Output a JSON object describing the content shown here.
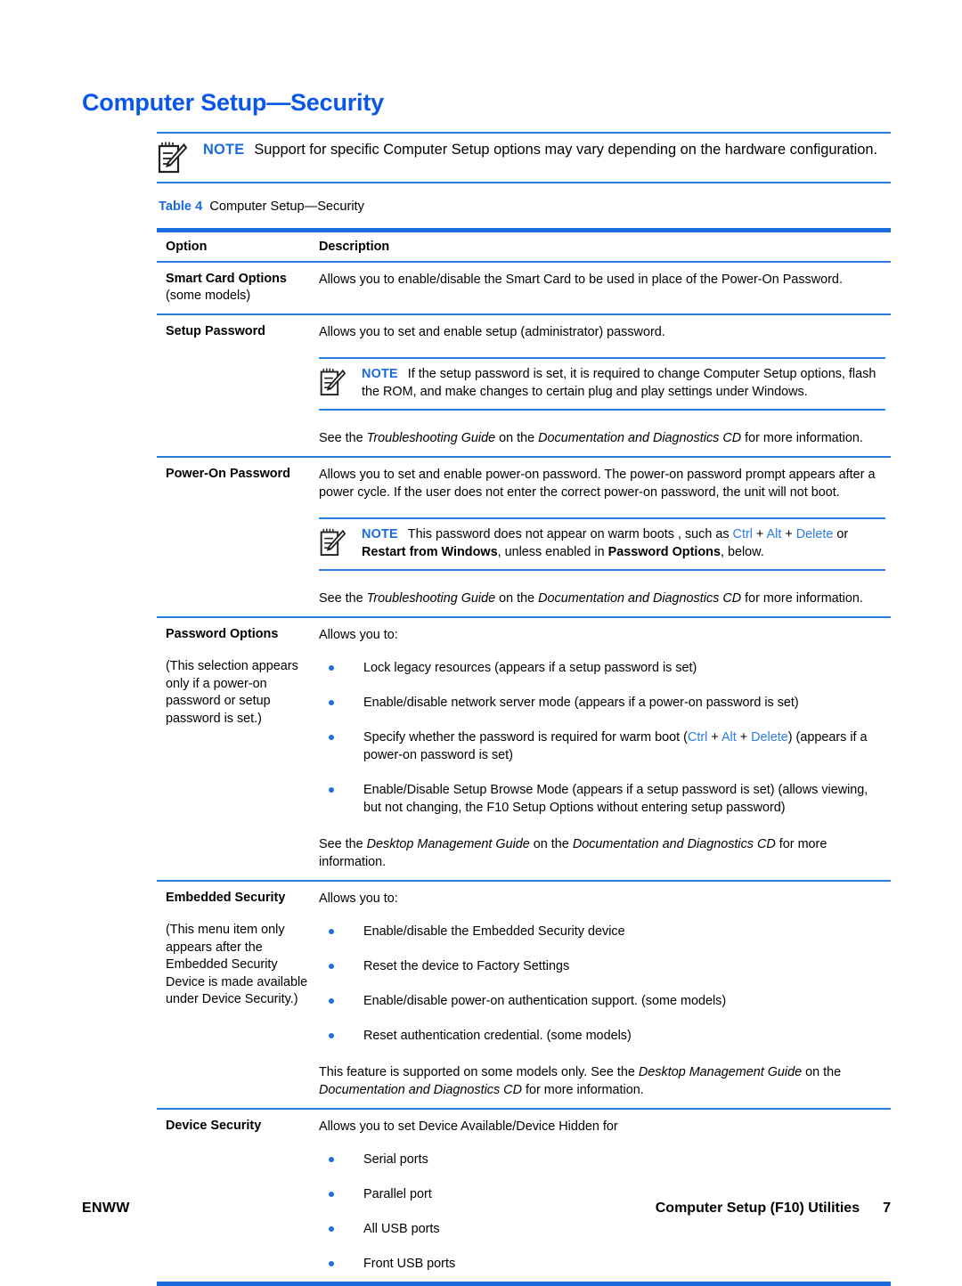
{
  "document": {
    "title": "Computer Setup—Security"
  },
  "top_note": {
    "icon": "note-pencil-icon",
    "label": "NOTE",
    "text": "Support for specific Computer Setup options may vary depending on the hardware configuration."
  },
  "table_caption": {
    "number": "Table 4",
    "title": "Computer Setup—Security"
  },
  "table": {
    "headers": {
      "option": "Option",
      "description": "Description"
    },
    "rows": [
      {
        "option_title": "Smart Card Options",
        "option_sub": "(some models)",
        "description": "Allows you to enable/disable the Smart Card to be used in place of the Power-On Password."
      },
      {
        "option_title": "Setup Password",
        "description": "Allows you to set and enable setup (administrator) password.",
        "note": {
          "icon": "note-pencil-icon",
          "label": "NOTE",
          "text": "If the setup password is set, it is required to change Computer Setup options, flash the ROM, and make changes to certain plug and play settings under Windows."
        },
        "see_also": {
          "lead": "See the ",
          "guide": "Troubleshooting Guide",
          "mid": " on the ",
          "cd": "Documentation and Diagnostics CD",
          "tail": " for more information."
        }
      },
      {
        "option_title": "Power-On Password",
        "description": "Allows you to set and enable power-on password. The power-on password prompt appears after a power cycle. If the user does not enter the correct power-on password, the unit will not boot.",
        "note": {
          "icon": "note-pencil-icon",
          "label": "NOTE",
          "part1": "This password does not appear on warm boots , such as ",
          "key1": "Ctrl",
          "plus1": " + ",
          "key2": "Alt",
          "plus2": " + ",
          "key3": "Delete",
          "part2": " or ",
          "bold1": "Restart from Windows",
          "part3": ", unless enabled in ",
          "bold2": "Password Options",
          "part4": ", below."
        },
        "see_also": {
          "lead": "See the ",
          "guide": "Troubleshooting Guide",
          "mid": " on the ",
          "cd": "Documentation and Diagnostics CD",
          "tail": " for more information."
        }
      },
      {
        "option_title": "Password Options",
        "option_note": "(This selection appears only if a power-on password or setup password is set.)",
        "description": "Allows you to:",
        "bullets": [
          "Lock legacy resources (appears if a setup password is set)",
          "Enable/disable network server mode (appears if a power-on password is set)",
          "Specify whether the password is required for warm boot (Ctrl + Alt + Delete) (appears if a power-on password is set)",
          "Enable/Disable Setup Browse Mode (appears if a setup password is set) (allows viewing, but not changing, the F10 Setup Options without entering setup password)"
        ],
        "bullet3_parts": {
          "pre": "Specify whether the password is required for warm boot (",
          "key1": "Ctrl",
          "plus1": " + ",
          "key2": "Alt",
          "plus2": " + ",
          "key3": "Delete",
          "post": ") (appears if a power-on password is set)"
        },
        "see_also": {
          "lead": "See the ",
          "guide": "Desktop Management Guide",
          "mid": " on the ",
          "cd": "Documentation and Diagnostics CD",
          "tail": " for more information."
        }
      },
      {
        "option_title": "Embedded Security",
        "option_note": "(This menu item only appears after the Embedded Security Device is made available under Device Security.)",
        "description": "Allows you to:",
        "bullets": [
          "Enable/disable the Embedded Security device",
          "Reset the device to Factory Settings",
          "Enable/disable power-on authentication support. (some models)",
          "Reset authentication credential. (some models)"
        ],
        "see_also": {
          "lead": "This feature is supported on some models only. See the ",
          "guide": "Desktop Management Guide",
          "mid": " on the ",
          "cd": "Documentation and Diagnostics CD",
          "tail": " for more information."
        }
      },
      {
        "option_title": "Device Security",
        "description": "Allows you to set Device Available/Device Hidden for",
        "bullets": [
          "Serial ports",
          "Parallel port",
          "All USB ports",
          "Front USB ports"
        ]
      }
    ]
  },
  "footer": {
    "left": "ENWW",
    "right": "Computer Setup (F10) Utilities",
    "page": "7"
  },
  "colors": {
    "heading_blue": "#0a56e8",
    "rule_blue": "#1a6ae0",
    "note_blue": "#2a7de1",
    "bullet_blue": "#1f6fe0"
  }
}
